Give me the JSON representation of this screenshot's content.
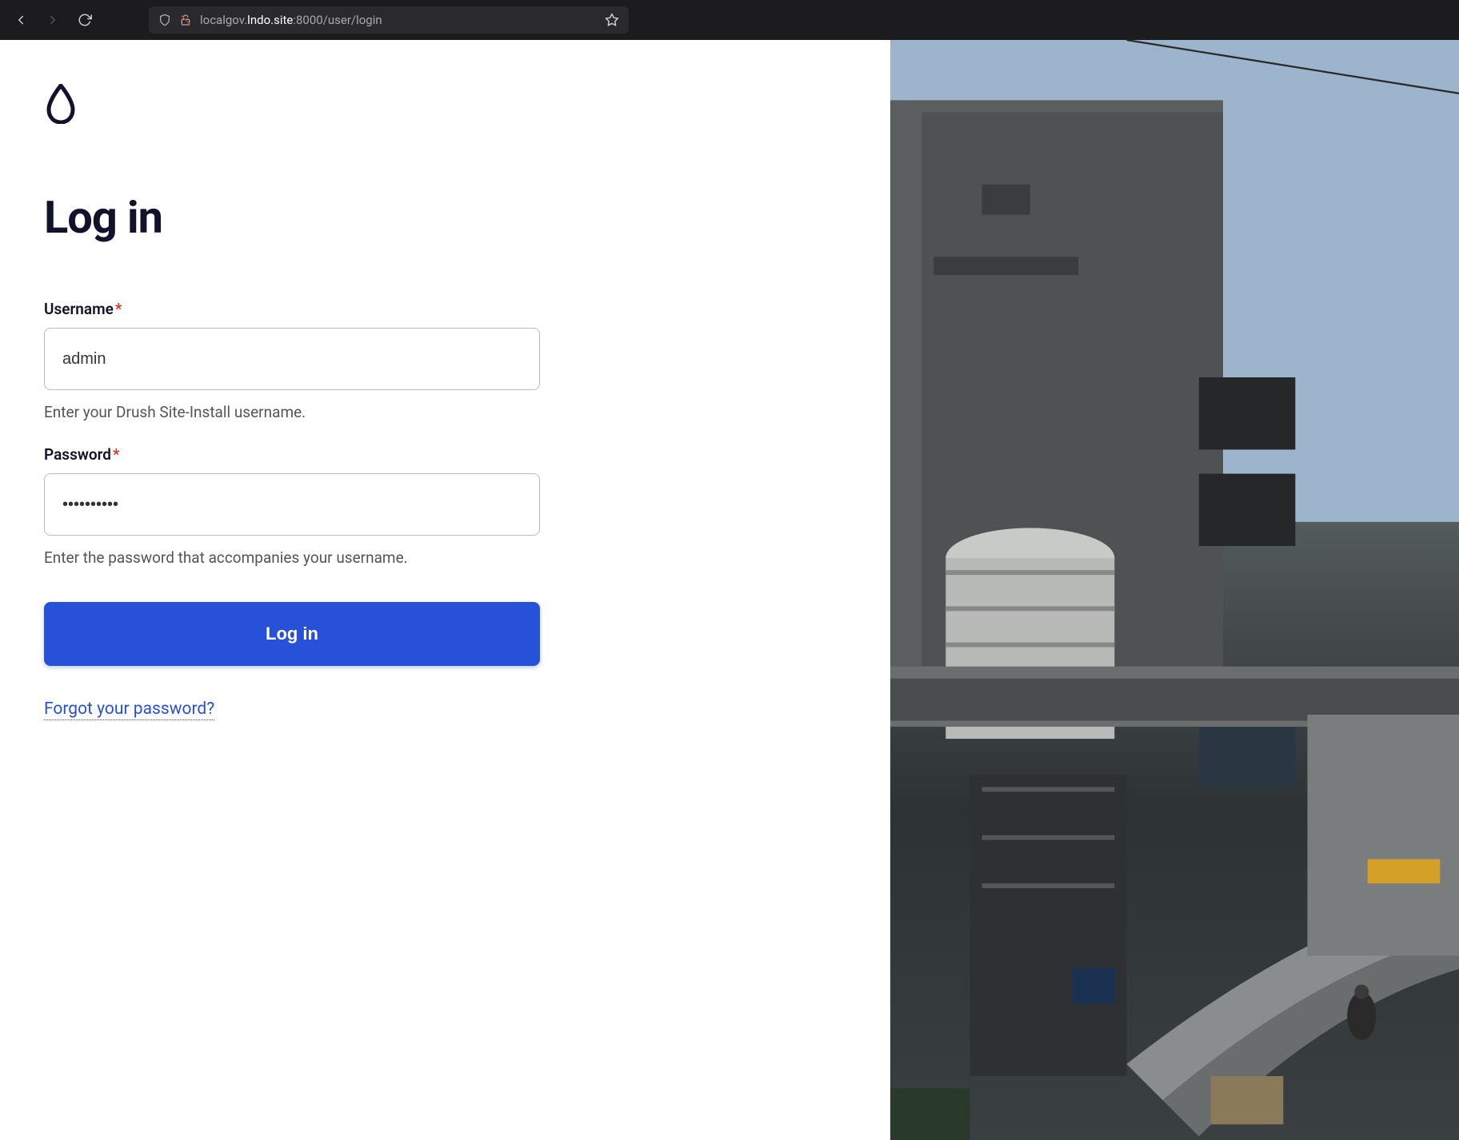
{
  "browser": {
    "url_prefix": "localgov.",
    "url_domain": "lndo.site",
    "url_suffix": ":8000/user/login"
  },
  "logo": {
    "name": "drupal-logo"
  },
  "page": {
    "title": "Log in"
  },
  "form": {
    "username": {
      "label": "Username",
      "value": "admin",
      "help": "Enter your Drush Site-Install username."
    },
    "password": {
      "label": "Password",
      "value": "••••••••••",
      "help": "Enter the password that accompanies your username."
    },
    "submit_label": "Log in",
    "forgot_link": "Forgot your password?"
  }
}
